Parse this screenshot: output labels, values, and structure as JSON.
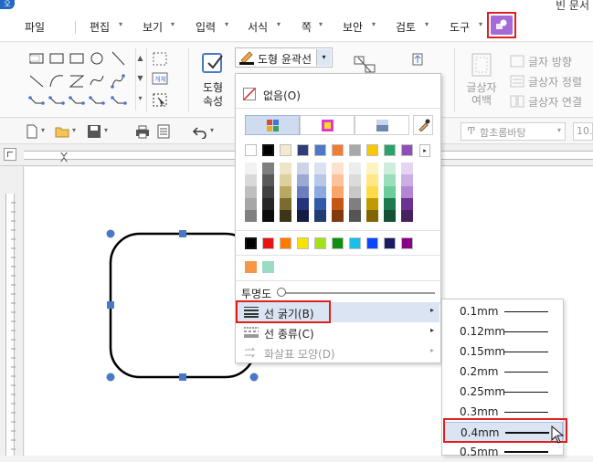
{
  "app": {
    "logo_text": "오",
    "window_title": "빈 문서"
  },
  "menubar": {
    "items": [
      {
        "label": "파일",
        "caret": false
      },
      {
        "label": "편집",
        "caret": true
      },
      {
        "label": "보기",
        "caret": true
      },
      {
        "label": "입력",
        "caret": true
      },
      {
        "label": "서식",
        "caret": true
      },
      {
        "label": "쪽",
        "caret": true
      },
      {
        "label": "보안",
        "caret": true
      },
      {
        "label": "검토",
        "caret": true
      },
      {
        "label": "도구",
        "caret": true
      }
    ]
  },
  "ribbon": {
    "shape_props_label_line1": "도형",
    "shape_props_label_line2": "속성",
    "outline_combo_label": "도형 윤곽선",
    "text_margin_line1": "글상자",
    "text_margin_line2": "여백",
    "text_direction": "글자 방향",
    "textbox_align": "글상자 정렬",
    "textbox_link": "글상자 연결",
    "font_name": "함초롬바탕",
    "font_size": "10."
  },
  "palette": {
    "none_label": "없음(O)",
    "transparency_label": "투명도",
    "line_thickness_label": "선 굵기(B)",
    "line_type_label": "선 종류(C)",
    "arrow_shape_label": "화살표 모양(D)",
    "row1_colors": [
      "#ffffff",
      "#000000",
      "#f5ead0",
      "#2f3e7a",
      "#4d78c8",
      "#f47c30",
      "#a9a9a9",
      "#f5c800",
      "#2aa36a",
      "#8e4fb8"
    ],
    "grad_columns": [
      [
        "#f2f2f2",
        "#d9d9d9",
        "#bfbfbf",
        "#a6a6a6",
        "#808080"
      ],
      [
        "#7f7f7f",
        "#595959",
        "#404040",
        "#262626",
        "#0d0d0d"
      ],
      [
        "#efe6c8",
        "#ddcf9e",
        "#b9a762",
        "#7b6b2e",
        "#3e3517"
      ],
      [
        "#cdd4ea",
        "#9ca9d4",
        "#6b7fbf",
        "#26327a",
        "#141c44"
      ],
      [
        "#dbe3f3",
        "#b7c8e8",
        "#8ea9dc",
        "#2f5ba8",
        "#1f3d70"
      ],
      [
        "#fde1cd",
        "#fbc39b",
        "#f9a66a",
        "#c45614",
        "#83390d"
      ],
      [
        "#ededed",
        "#dbdbdb",
        "#c8c8c8",
        "#7f7f7f",
        "#555555"
      ],
      [
        "#fff3c2",
        "#ffe785",
        "#ffdb48",
        "#c29a00",
        "#816600"
      ],
      [
        "#cdeedd",
        "#9cddbc",
        "#6acd9a",
        "#1f7a4f",
        "#145135"
      ],
      [
        "#e6d5f0",
        "#cdaee2",
        "#b385d3",
        "#6b3290",
        "#47215f"
      ]
    ],
    "standard_colors": [
      "#000000",
      "#e81414",
      "#ff7a00",
      "#f5e400",
      "#a4e01c",
      "#0e8f0e",
      "#17c0e8",
      "#0a45ff",
      "#1b1b66",
      "#870087"
    ],
    "recent_colors": [
      "#f79646",
      "#9bdbc0"
    ]
  },
  "thickness_submenu": {
    "items": [
      {
        "label": "0.1mm",
        "weight": 1
      },
      {
        "label": "0.12mm",
        "weight": 1
      },
      {
        "label": "0.15mm",
        "weight": 1
      },
      {
        "label": "0.2mm",
        "weight": 1
      },
      {
        "label": "0.25mm",
        "weight": 1
      },
      {
        "label": "0.3mm",
        "weight": 1
      },
      {
        "label": "0.4mm",
        "weight": 2
      },
      {
        "label": "0.5mm",
        "weight": 2
      }
    ],
    "selected": "0.4mm"
  },
  "colors": {
    "accent_purple": "#a46bd6",
    "highlight_red": "#e02020",
    "selection_blue": "#dde6f5",
    "handle_blue": "#4a78c8"
  }
}
